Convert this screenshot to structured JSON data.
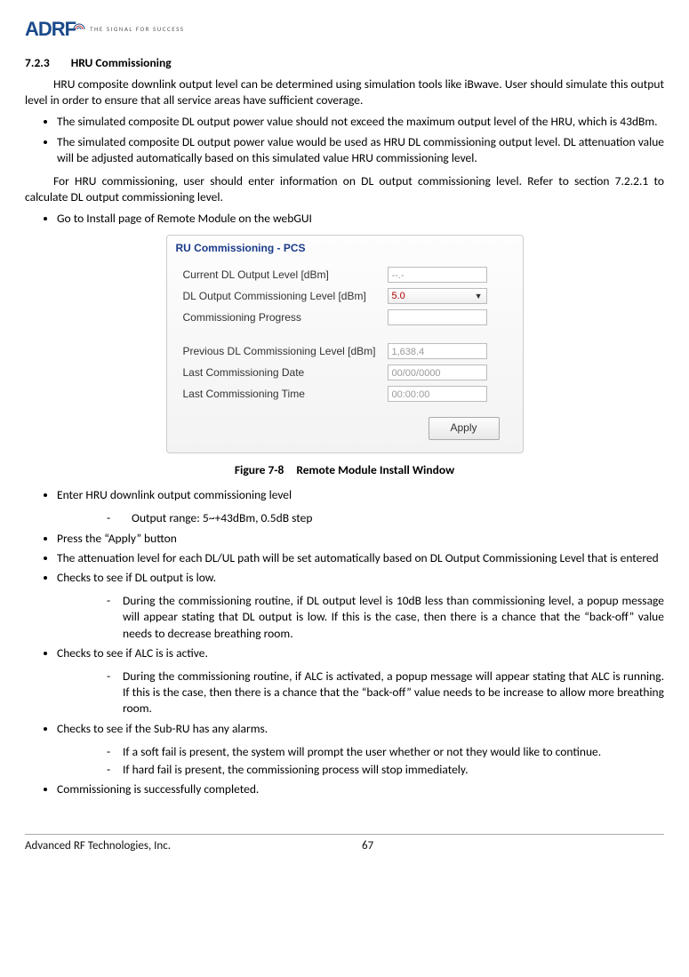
{
  "header": {
    "logo_text": "ADRF",
    "tagline": "THE SIGNAL FOR SUCCESS"
  },
  "section": {
    "number": "7.2.3",
    "title": "HRU Commissioning",
    "para1": "HRU composite downlink output level can be determined using simulation tools like iBwave. User should simulate this output level in order to ensure that all service areas have sufficient coverage.",
    "bullets1": [
      "The simulated composite DL output power value should not exceed the maximum output level of the HRU, which is 43dBm.",
      "The simulated composite DL output power value would be used as HRU DL commissioning output level.  DL attenuation value will be adjusted automatically based on this simulated value HRU commissioning level."
    ],
    "para2": "For HRU commissioning, user should enter information on DL output commissioning level. Refer to section 7.2.2.1 to calculate DL output commissioning level.",
    "bullets2_first": "Go to Install page of Remote Module on the webGUI",
    "figure_label": "Figure 7-8",
    "figure_title": "Remote Module Install Window",
    "bullets_after": [
      "Enter HRU downlink output commissioning level",
      "Press the “Apply” button",
      "The attenuation level for each DL/UL path will be set automatically based on DL Output Commissioning Level that is entered",
      "Checks to see if DL output is low.",
      "Checks to see if ALC is is active.",
      "Checks to see if the Sub-RU has any alarms.",
      "Commissioning is successfully completed."
    ],
    "sub_output_range": "Output range: 5~+43dBm, 0.5dB step",
    "sub_dl_low": "During the commissioning routine, if DL output level is 10dB less than commissioning level, a popup message will appear stating that DL output is low. If this is the case, then there is a chance that the “back-off” value needs to decrease breathing room.",
    "sub_alc": "During the commissioning routine, if ALC is activated, a popup message will appear stating that ALC is running.  If this is the case, then there is a chance that the “back-off” value needs to be increase to allow more breathing room.",
    "sub_alarm1": "If a soft fail is present, the system will prompt the user whether or not they would like to continue.",
    "sub_alarm2": "If hard fail is present, the commissioning process will stop immediately."
  },
  "gui": {
    "title": "RU Commissioning - PCS",
    "rows": {
      "r1_label": "Current DL Output Level [dBm]",
      "r1_value": "--.-",
      "r2_label": "DL Output Commissioning Level [dBm]",
      "r2_value": "5.0",
      "r3_label": "Commissioning Progress",
      "r3_value": "",
      "r4_label": "Previous DL Commissioning Level [dBm]",
      "r4_value": "1,638.4",
      "r5_label": "Last Commissioning Date",
      "r5_value": "00/00/0000",
      "r6_label": "Last Commissioning Time",
      "r6_value": "00:00:00"
    },
    "apply_label": "Apply"
  },
  "footer": {
    "company": "Advanced RF Technologies, Inc.",
    "page": "67"
  }
}
